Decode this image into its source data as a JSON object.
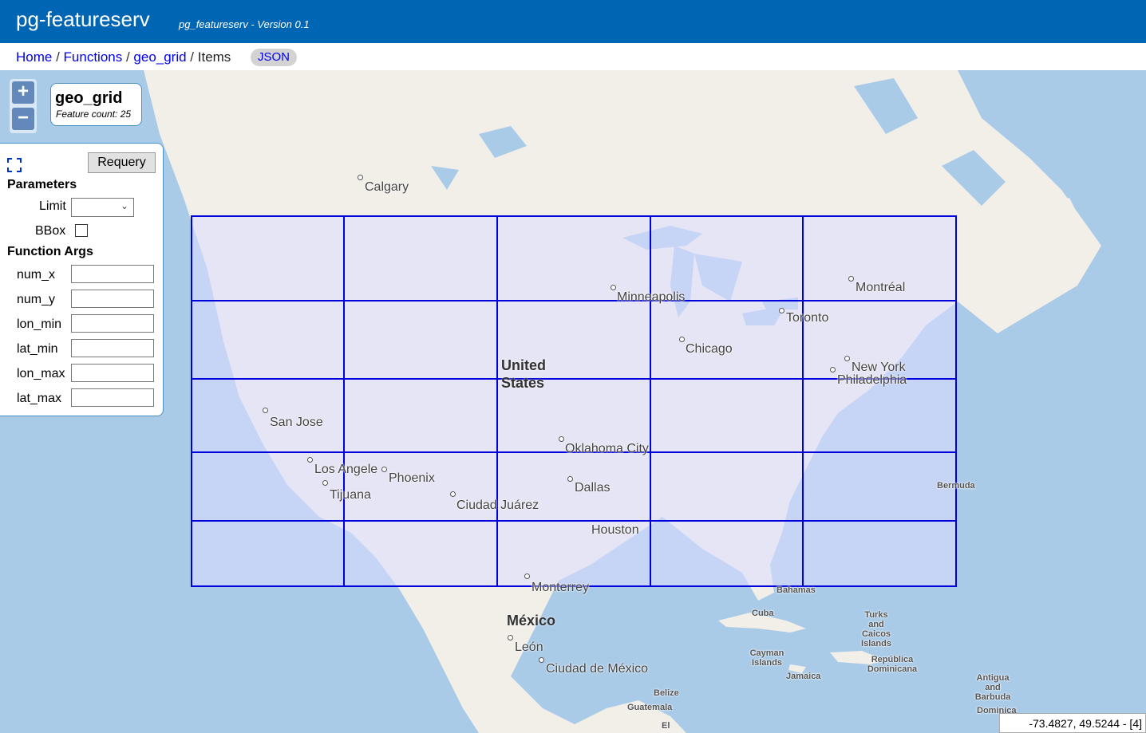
{
  "header": {
    "title": "pg-featureserv",
    "version": "pg_featureserv - Version 0.1"
  },
  "breadcrumb": {
    "home": "Home",
    "functions": "Functions",
    "geo_grid": "geo_grid",
    "current": "Items",
    "json_button": "JSON"
  },
  "layer_box": {
    "name": "geo_grid",
    "feature_count": "Feature count: 25"
  },
  "panel": {
    "requery_label": "Requery",
    "parameters_heading": "Parameters",
    "limit_label": "Limit",
    "bbox_label": "BBox",
    "function_args_heading": "Function Args",
    "args": [
      "num_x",
      "num_y",
      "lon_min",
      "lat_min",
      "lon_max",
      "lat_max"
    ]
  },
  "map_labels": {
    "calgary": "Calgary",
    "minneapolis": "Minneapolis",
    "montreal": "Montréal",
    "toronto": "Toronto",
    "chicago": "Chicago",
    "new_york": "New York",
    "philadelphia": "Philadelphia",
    "united_states": "United States",
    "san_jose": "San Jose",
    "los_angeles": "Los Angele",
    "phoenix": "Phoenix",
    "tijuana": "Tijuana",
    "ciudad_juarez": "Ciudad Juárez",
    "dallas": "Dallas",
    "oklahoma_city": "Oklahoma City",
    "houston": "Houston",
    "bermuda": "Bermuda",
    "monterrey": "Monterrey",
    "mexico": "México",
    "bahamas": "Bahamas",
    "cuba": "Cuba",
    "turks_caicos": "Turks and Caicos Islands",
    "leon": "León",
    "cayman": "Cayman Islands",
    "republica_dominicana": "República Dominicana",
    "ciudad_de_mexico": "Ciudad de México",
    "jamaica": "Jamaica",
    "antigua": "Antigua and Barbuda",
    "belize": "Belize",
    "guatemala": "Guatemala",
    "dominica": "Dominica",
    "el": "El"
  },
  "grid": {
    "color": "#0000dd",
    "fill": "#ddddff",
    "num_x": 5,
    "num_y": 5,
    "feature_count": 25
  },
  "coords": "-73.4827, 49.5244 - [4]"
}
